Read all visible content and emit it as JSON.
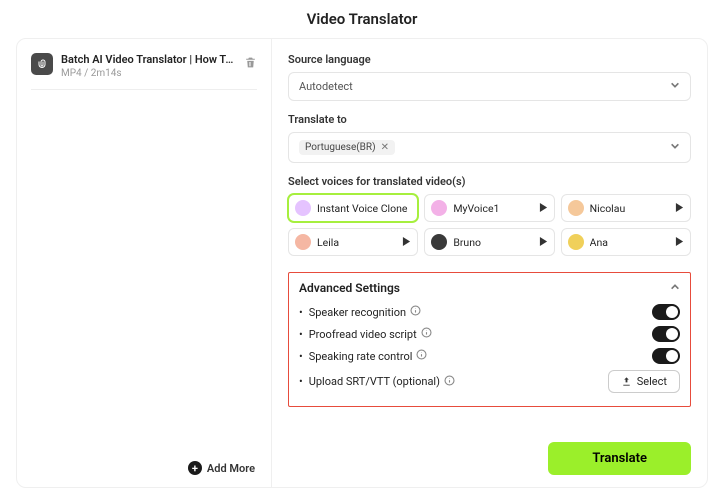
{
  "title": "Video Translator",
  "file": {
    "name": "Batch AI Video Translator | How To Bat…",
    "format": "MP4",
    "duration": "2m14s"
  },
  "add_more_label": "Add More",
  "source_language": {
    "label": "Source language",
    "value": "Autodetect"
  },
  "translate_to": {
    "label": "Translate to",
    "value": "Portuguese(BR)"
  },
  "voices_label": "Select voices for translated video(s)",
  "voices": [
    {
      "name": "Instant Voice Clone",
      "selected": true,
      "play": false,
      "avatar": "#e5c3ff"
    },
    {
      "name": "MyVoice1",
      "selected": false,
      "play": true,
      "avatar": "#f3b1e7"
    },
    {
      "name": "Nicolau",
      "selected": false,
      "play": true,
      "avatar": "#f5c89a"
    },
    {
      "name": "Leila",
      "selected": false,
      "play": true,
      "avatar": "#f5b7a3"
    },
    {
      "name": "Bruno",
      "selected": false,
      "play": true,
      "avatar": "#3a3a3a"
    },
    {
      "name": "Ana",
      "selected": false,
      "play": true,
      "avatar": "#f0d05a"
    }
  ],
  "advanced": {
    "title": "Advanced Settings",
    "speaker_recognition": "Speaker recognition",
    "proofread": "Proofread video script",
    "speaking_rate": "Speaking rate control",
    "upload_srt": "Upload SRT/VTT (optional)",
    "select_button": "Select"
  },
  "translate_button": "Translate"
}
